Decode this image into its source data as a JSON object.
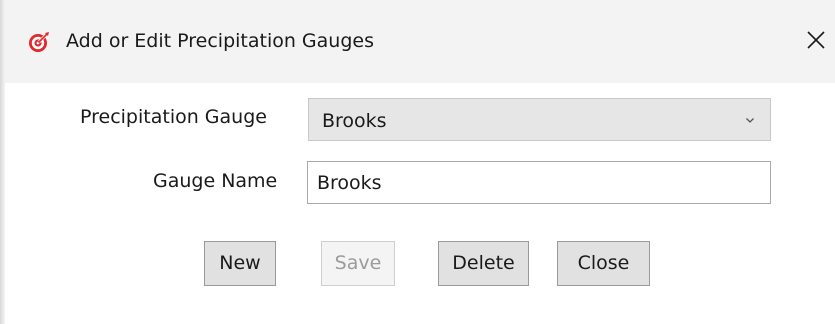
{
  "window": {
    "title": "Add or Edit Precipitation Gauges",
    "icon": "target-icon",
    "accent_color": "#e0282e"
  },
  "form": {
    "gauge_label": "Precipitation Gauge",
    "gauge_selected": "Brooks",
    "name_label": "Gauge Name",
    "name_value": "Brooks"
  },
  "buttons": {
    "new": "New",
    "save": "Save",
    "delete": "Delete",
    "close": "Close"
  }
}
